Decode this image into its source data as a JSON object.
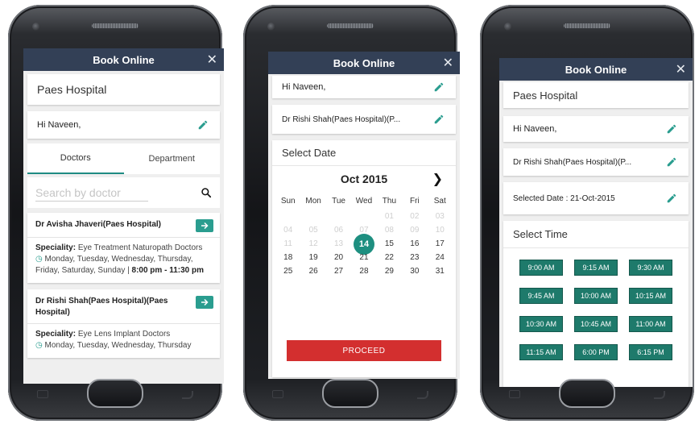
{
  "colors": {
    "header": "#334056",
    "accent": "#2a9d8f",
    "proceed": "#d32f2f",
    "slot": "#1e7a6b"
  },
  "screen1": {
    "title": "Book Online",
    "hospital": "Paes Hospital",
    "greeting": "Hi Naveen,",
    "tabs": [
      "Doctors",
      "Department"
    ],
    "search_placeholder": "Search by doctor",
    "doctors": [
      {
        "name": "Dr Avisha Jhaveri(Paes Hospital)",
        "speciality_label": "Speciality:",
        "speciality": "Eye Treatment Naturopath Doctors",
        "days": "Monday, Tuesday, Wednesday, Thursday, Friday, Saturday, Sunday |",
        "time": "8:00 pm - 11:30 pm"
      },
      {
        "name": "Dr Rishi Shah(Paes Hospital)(Paes Hospital)",
        "speciality_label": "Speciality:",
        "speciality": "Eye Lens Implant Doctors",
        "days": "Monday, Tuesday, Wednesday, Thursday"
      }
    ]
  },
  "screen2": {
    "title": "Book Online",
    "greeting": "Hi Naveen,",
    "doctor": "Dr Rishi Shah(Paes Hospital)(P...",
    "select_date": "Select Date",
    "month": "Oct 2015",
    "weekdays": [
      "Sun",
      "Mon",
      "Tue",
      "Wed",
      "Thu",
      "Fri",
      "Sat"
    ],
    "weeks": [
      [
        "",
        "",
        "",
        "",
        "01",
        "02",
        "03"
      ],
      [
        "04",
        "05",
        "06",
        "07",
        "08",
        "09",
        "10"
      ],
      [
        "11",
        "12",
        "13",
        "14",
        "15",
        "16",
        "17"
      ],
      [
        "18",
        "19",
        "20",
        "21",
        "22",
        "23",
        "24"
      ],
      [
        "25",
        "26",
        "27",
        "28",
        "29",
        "30",
        "31"
      ]
    ],
    "disabled_until": "13",
    "selected": "14",
    "proceed": "PROCEED"
  },
  "screen3": {
    "title": "Book Online",
    "hospital": "Paes Hospital",
    "greeting": "Hi Naveen,",
    "doctor": "Dr Rishi Shah(Paes Hospital)(P...",
    "selected_date": "Selected Date : 21-Oct-2015",
    "select_time": "Select Time",
    "slots": [
      "9:00 AM",
      "9:15 AM",
      "9:30 AM",
      "9:45 AM",
      "10:00 AM",
      "10:15 AM",
      "10:30 AM",
      "10:45 AM",
      "11:00 AM",
      "11:15 AM",
      "6:00 PM",
      "6:15 PM"
    ]
  }
}
